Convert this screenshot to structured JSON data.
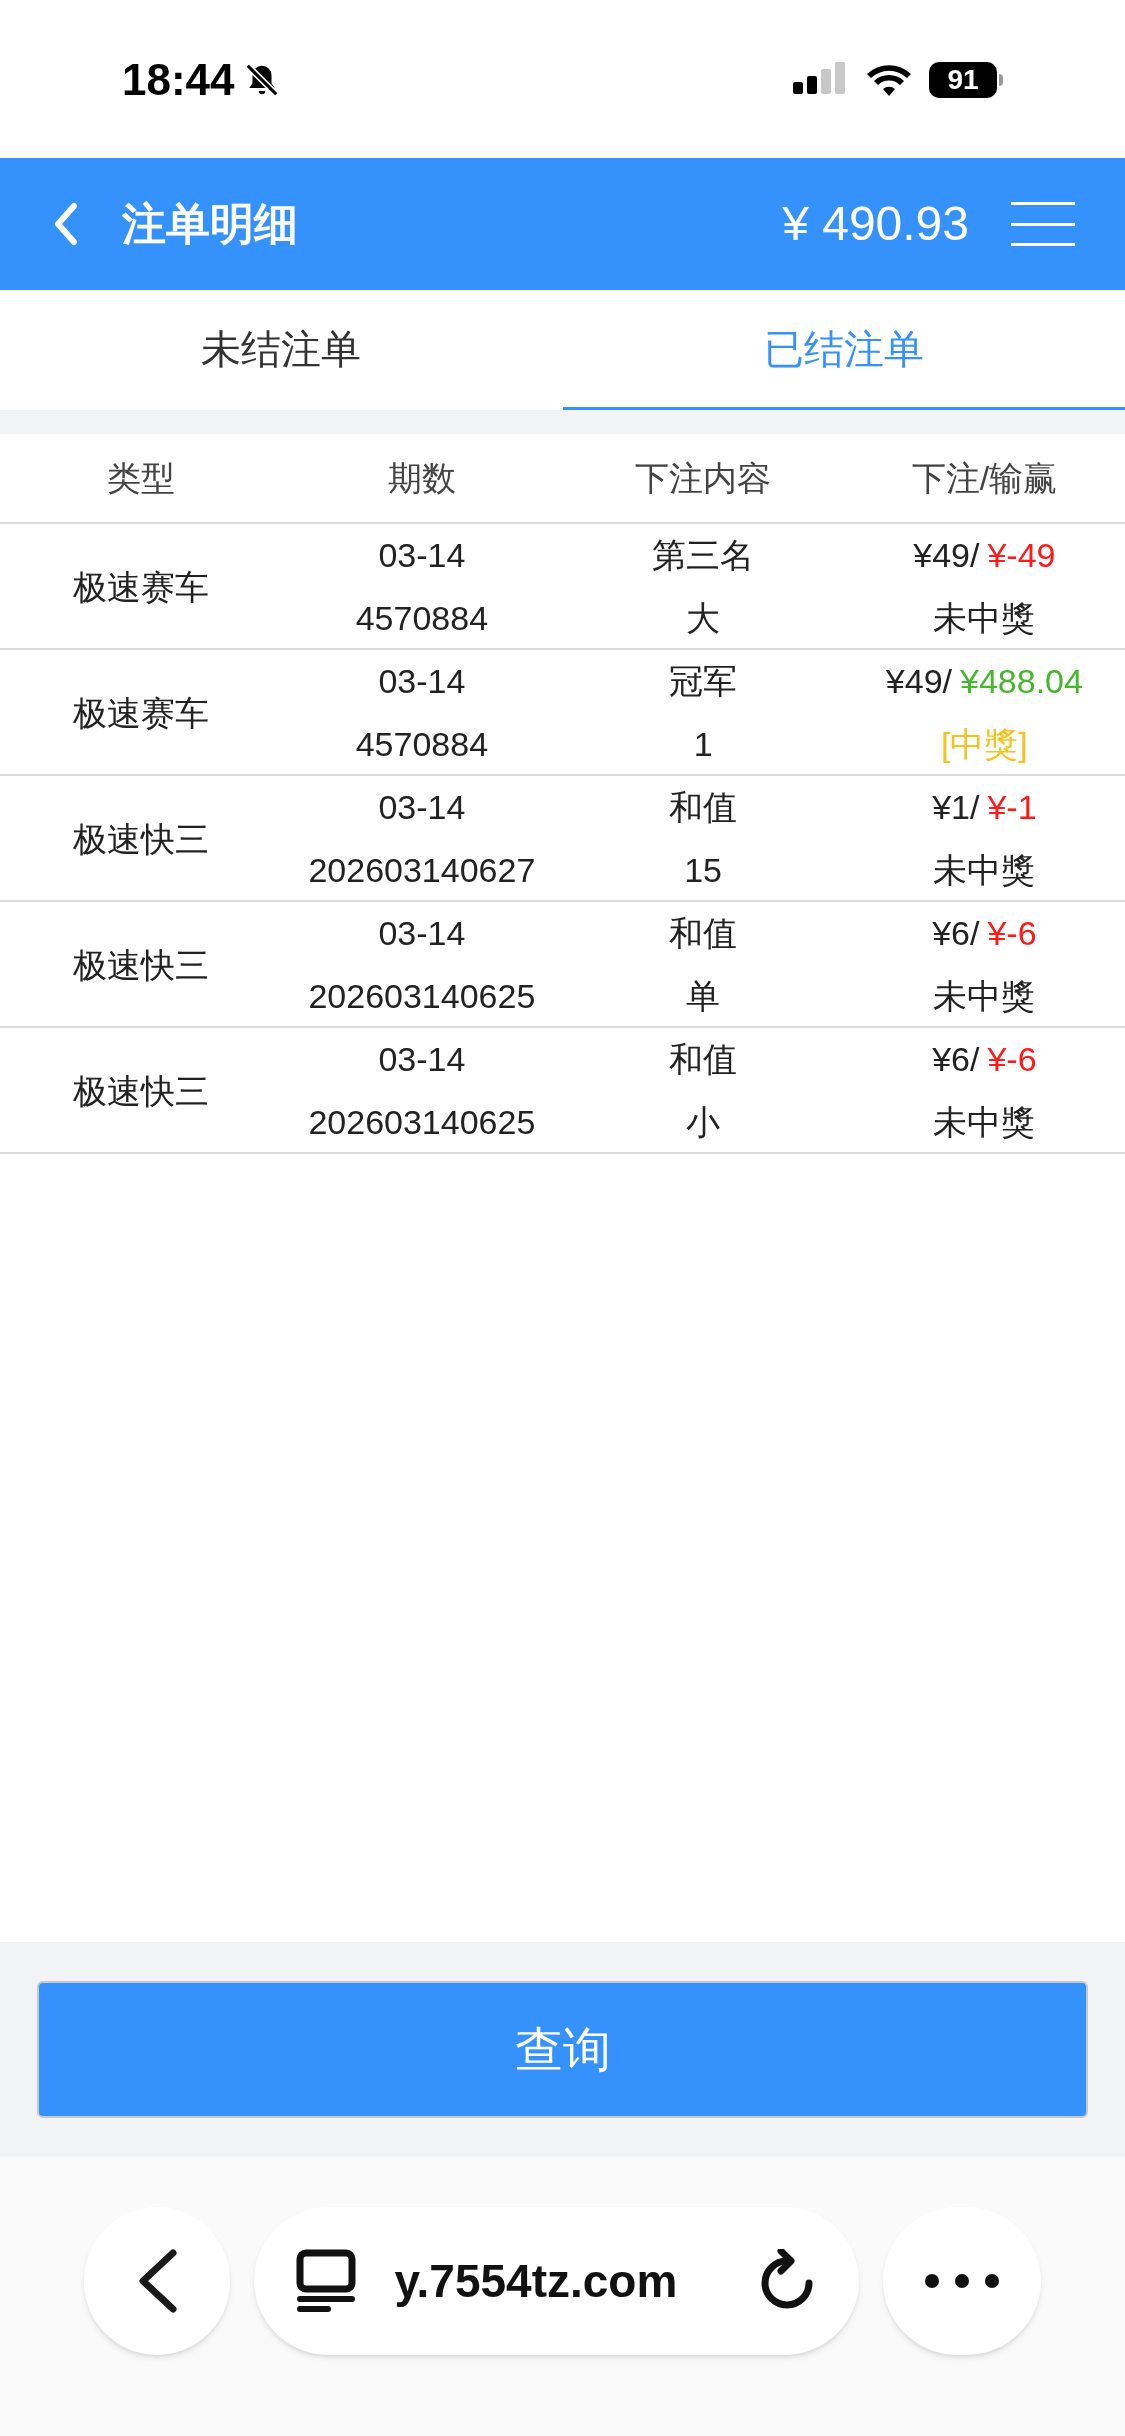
{
  "status_bar": {
    "time": "18:44",
    "battery": "91"
  },
  "header": {
    "title": "注单明细",
    "balance": "¥ 490.93"
  },
  "tabs": [
    {
      "label": "未结注单",
      "selected": false
    },
    {
      "label": "已结注单",
      "selected": true
    }
  ],
  "table": {
    "columns": [
      "类型",
      "期数",
      "下注内容",
      "下注/输赢"
    ],
    "rows": [
      {
        "kind": "lose",
        "type": "极速赛车",
        "date": "03-14",
        "issue": "4570884",
        "bet_line1": "第三名",
        "bet_line2": "大",
        "stake": "¥49/",
        "payout": "¥-49",
        "result": "未中獎"
      },
      {
        "kind": "win",
        "type": "极速赛车",
        "date": "03-14",
        "issue": "4570884",
        "bet_line1": "冠军",
        "bet_line2": "1",
        "stake": "¥49/",
        "payout": "¥488.04",
        "result": "[中獎]"
      },
      {
        "kind": "lose",
        "type": "极速快三",
        "date": "03-14",
        "issue": "202603140627",
        "bet_line1": "和值",
        "bet_line2": "15",
        "stake": "¥1/",
        "payout": "¥-1",
        "result": "未中獎"
      },
      {
        "kind": "lose",
        "type": "极速快三",
        "date": "03-14",
        "issue": "202603140625",
        "bet_line1": "和值",
        "bet_line2": "单",
        "stake": "¥6/",
        "payout": "¥-6",
        "result": "未中獎"
      },
      {
        "kind": "lose",
        "type": "极速快三",
        "date": "03-14",
        "issue": "202603140625",
        "bet_line1": "和值",
        "bet_line2": "小",
        "stake": "¥6/",
        "payout": "¥-6",
        "result": "未中獎"
      }
    ]
  },
  "query_button": "查询",
  "browser_bar": {
    "url": "y.7554tz.com"
  }
}
